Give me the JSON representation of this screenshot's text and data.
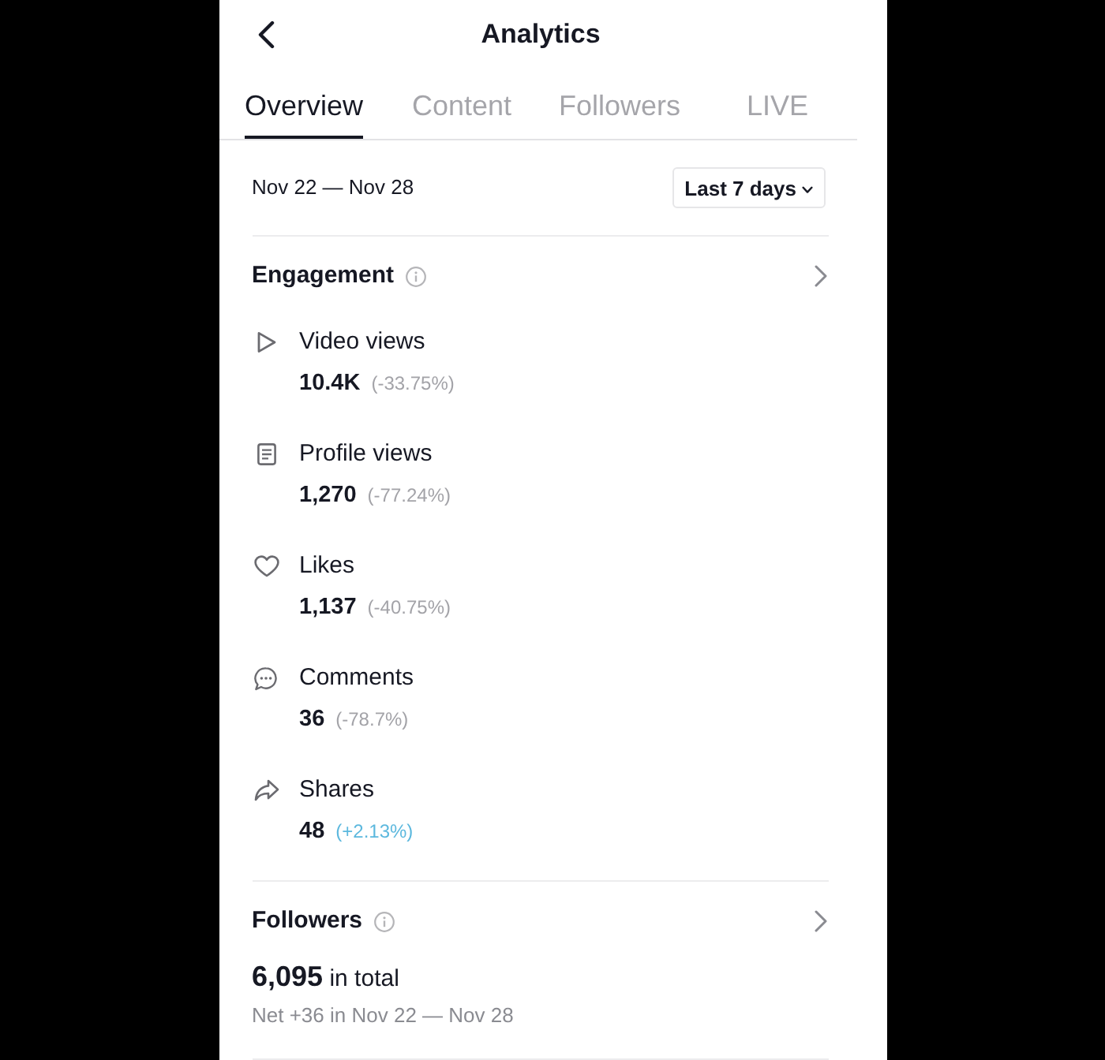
{
  "screen": {
    "title": "Analytics"
  },
  "tabs": [
    {
      "label": "Overview",
      "selected": true
    },
    {
      "label": "Content",
      "selected": false
    },
    {
      "label": "Followers",
      "selected": false
    },
    {
      "label": "LIVE",
      "selected": false
    }
  ],
  "date_range": {
    "label": "Nov 22 — Nov 28",
    "dropdown": "Last 7 days"
  },
  "engagement": {
    "title": "Engagement",
    "metrics": [
      {
        "kind": "play",
        "label": "Video views",
        "value": "10.4K",
        "change": "(-33.75%)",
        "color": "#a3a3a8"
      },
      {
        "kind": "document",
        "label": "Profile views",
        "value": "1,270",
        "change": "(-77.24%)",
        "color": "#a3a3a8"
      },
      {
        "kind": "heart",
        "label": "Likes",
        "value": "1,137",
        "change": "(-40.75%)",
        "color": "#a3a3a8"
      },
      {
        "kind": "comment",
        "label": "Comments",
        "value": "36",
        "change": "(-78.7%)",
        "color": "#a3a3a8"
      },
      {
        "kind": "share",
        "label": "Shares",
        "value": "48",
        "change": "(+2.13%)",
        "color": "#5cb8de"
      }
    ]
  },
  "followers": {
    "title": "Followers",
    "total": "**6,095** in total",
    "net": "Net +36 in Nov 22 — Nov 28"
  }
}
